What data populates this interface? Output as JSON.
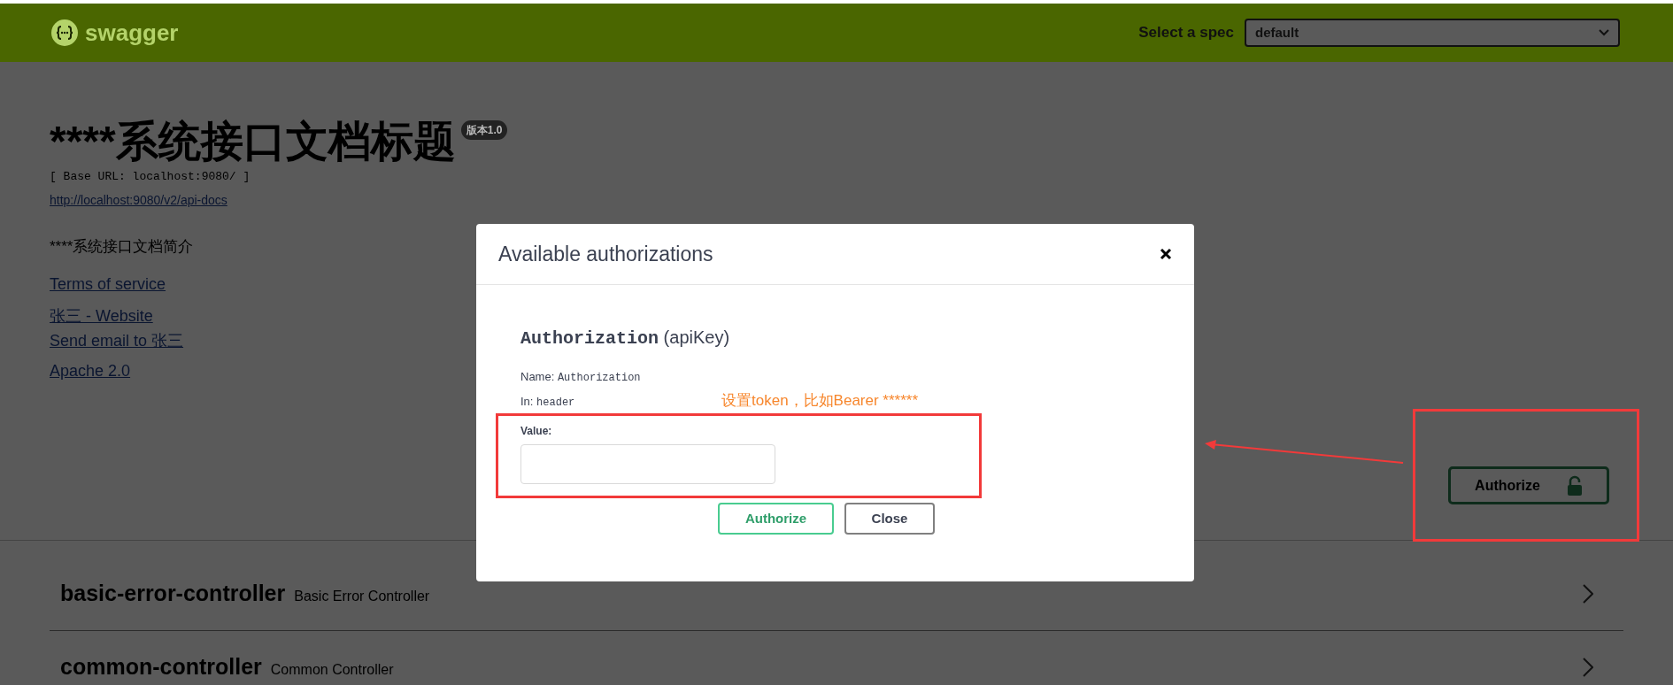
{
  "topbar": {
    "logo_text": "swagger",
    "spec_label": "Select a spec",
    "spec_value": "default"
  },
  "info": {
    "title": "****系统接口文档标题",
    "version": "版本1.0",
    "base_url": "[ Base URL: localhost:9080/ ]",
    "api_docs_link": "http://localhost:9080/v2/api-docs",
    "description": "****系统接口文档简介",
    "links": [
      "Terms of service",
      "张三 - Website",
      "Send email to 张三",
      "Apache 2.0"
    ]
  },
  "authorize_button": {
    "label": "Authorize"
  },
  "tags": [
    {
      "name": "basic-error-controller",
      "description": "Basic Error Controller"
    },
    {
      "name": "common-controller",
      "description": "Common Controller"
    }
  ],
  "modal": {
    "title": "Available authorizations",
    "scheme_name": "Authorization",
    "scheme_type": "(apiKey)",
    "name_label": "Name:",
    "name_value": "Authorization",
    "in_label": "In:",
    "in_value": "header",
    "value_label": "Value:",
    "buttons": [
      {
        "label": "Authorize",
        "kind": "primary"
      },
      {
        "label": "Close",
        "kind": "cancel"
      }
    ]
  },
  "annotation": {
    "text": "设置token，比如Bearer ******"
  }
}
